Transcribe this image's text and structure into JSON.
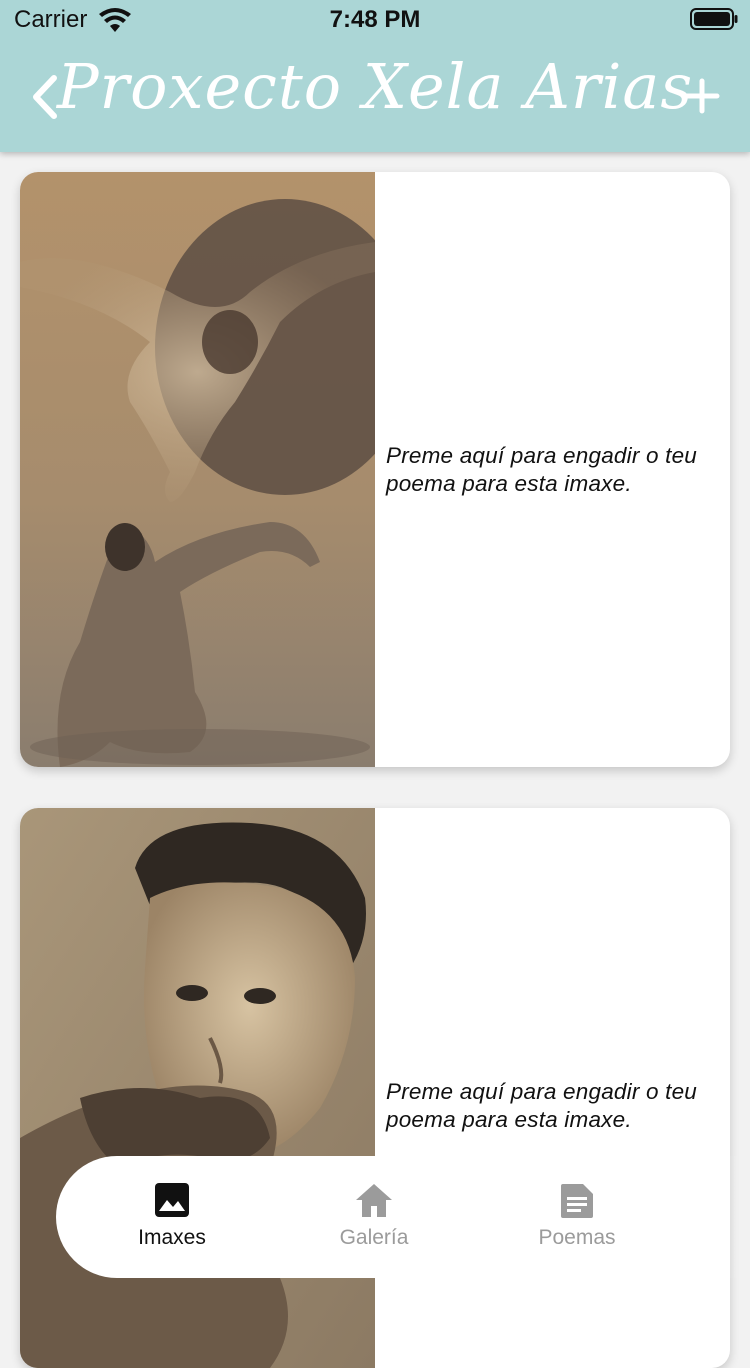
{
  "status": {
    "carrier": "Carrier",
    "time": "7:48 PM"
  },
  "nav": {
    "title": "Proxecto Xela Arias"
  },
  "cards": [
    {
      "prompt": "Preme aquí para engadir o teu poema para esta imaxe."
    },
    {
      "prompt": "Preme aquí para engadir o teu poema para esta imaxe."
    }
  ],
  "tabs": [
    {
      "label": "Imaxes",
      "icon": "image-icon",
      "selected": true
    },
    {
      "label": "Galería",
      "icon": "home-icon",
      "selected": false
    },
    {
      "label": "Poemas",
      "icon": "document-icon",
      "selected": false
    }
  ],
  "colors": {
    "header": "#abd6d6",
    "tab_active": "#111111",
    "tab_inactive": "#9b9b9b"
  }
}
